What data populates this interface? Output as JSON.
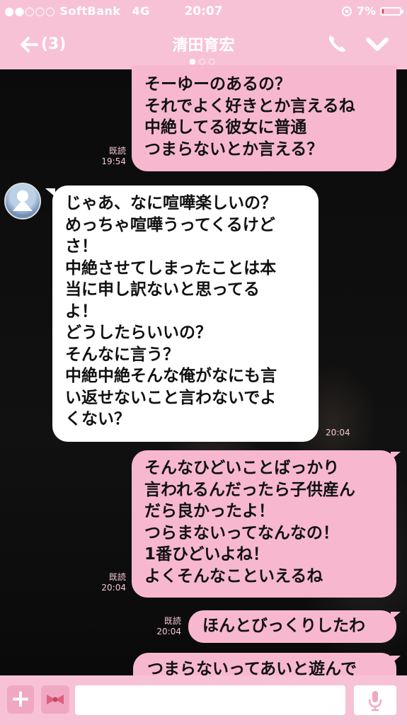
{
  "status_bar": {
    "signal": "●●○○○",
    "carrier": "SoftBank",
    "network": "4G",
    "time": "20:07",
    "battery_percent": "7%",
    "battery_level": 0.07
  },
  "header": {
    "back_label": "(3)",
    "contact_name": "清田育宏",
    "page_dots": "●○○"
  },
  "messages": [
    {
      "sender": "me",
      "lines": [
        "そーゆーのあるの？",
        "それでよく好きとか言えるね",
        "中絶してる彼女に普通",
        "つまらないとか言える？"
      ],
      "read": "既読",
      "time": "19:54"
    },
    {
      "sender": "them",
      "lines": [
        "じゃあ、なに喧嘩楽しいの？",
        "めっちゃ喧嘩うってくるけど",
        "さ！",
        "中絶させてしまったことは本",
        "当に申し訳ないと思ってる",
        "よ！",
        "どうしたらいいの？",
        "そんなに言う？",
        "中絶中絶そんな俺がなにも言",
        "い返せないこと言わないでよ",
        "くない？"
      ],
      "time": "20:04"
    },
    {
      "sender": "me",
      "lines": [
        "そんなひどいことばっかり",
        "言われるんだったら子供産ん",
        "だら良かったよ！",
        "つらまないってなんなの！",
        "1番ひどいよね！",
        "よくそんなこといえるね"
      ],
      "read": "既読",
      "time": "20:04"
    },
    {
      "sender": "me",
      "lines": [
        "ほんとびっくりしたわ"
      ],
      "read": "既読",
      "time": "20:04"
    },
    {
      "sender": "me",
      "lines": [
        "つまらないってあいと遊んで"
      ]
    }
  ],
  "colors": {
    "bar_pink": "#f7c2d6",
    "bubble_pink": "#f7b8cf",
    "bubble_white": "#ffffff"
  },
  "icons": {
    "back": "left-arrow-icon",
    "call": "phone-icon",
    "menu": "chevron-down-icon",
    "attach": "plus-icon",
    "sticker": "hello-kitty-bow-icon",
    "voice": "mic-icon"
  }
}
